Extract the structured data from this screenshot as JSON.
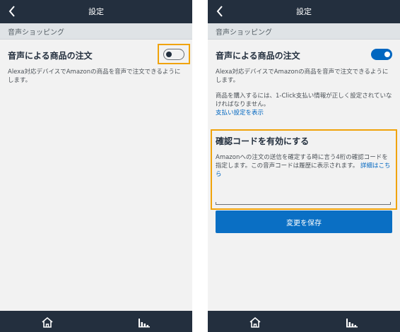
{
  "screens": [
    {
      "title": "設定",
      "section_header": "音声ショッピング",
      "setting_label": "音声による商品の注文",
      "toggle_state": "off",
      "description": "Alexa対応デバイスでAmazonの商品を音声で注文できるようにします。"
    },
    {
      "title": "設定",
      "section_header": "音声ショッピング",
      "setting_label": "音声による商品の注文",
      "toggle_state": "on",
      "description": "Alexa対応デバイスでAmazonの商品を音声で注文できるようにします。",
      "purchase_note": "商品を購入するには、1-Click支払い情報が正しく設定されていなければなりません。",
      "payment_link": "支払い設定を表示",
      "confirm_code_title": "確認コードを有効にする",
      "confirm_code_desc": "Amazonへの注文の送信を確定する時に言う4桁の確認コードを指定します。この音声コードは履歴に表示されます。",
      "details_link": "詳細はこちら",
      "save_label": "変更を保存"
    }
  ],
  "icons": {
    "back": "chevron-left-icon",
    "home": "home-icon",
    "activity": "bars-icon"
  },
  "colors": {
    "navbar": "#232f3e",
    "accent": "#0066c0",
    "highlight": "#f0a30a",
    "background": "#f2f2f2"
  }
}
